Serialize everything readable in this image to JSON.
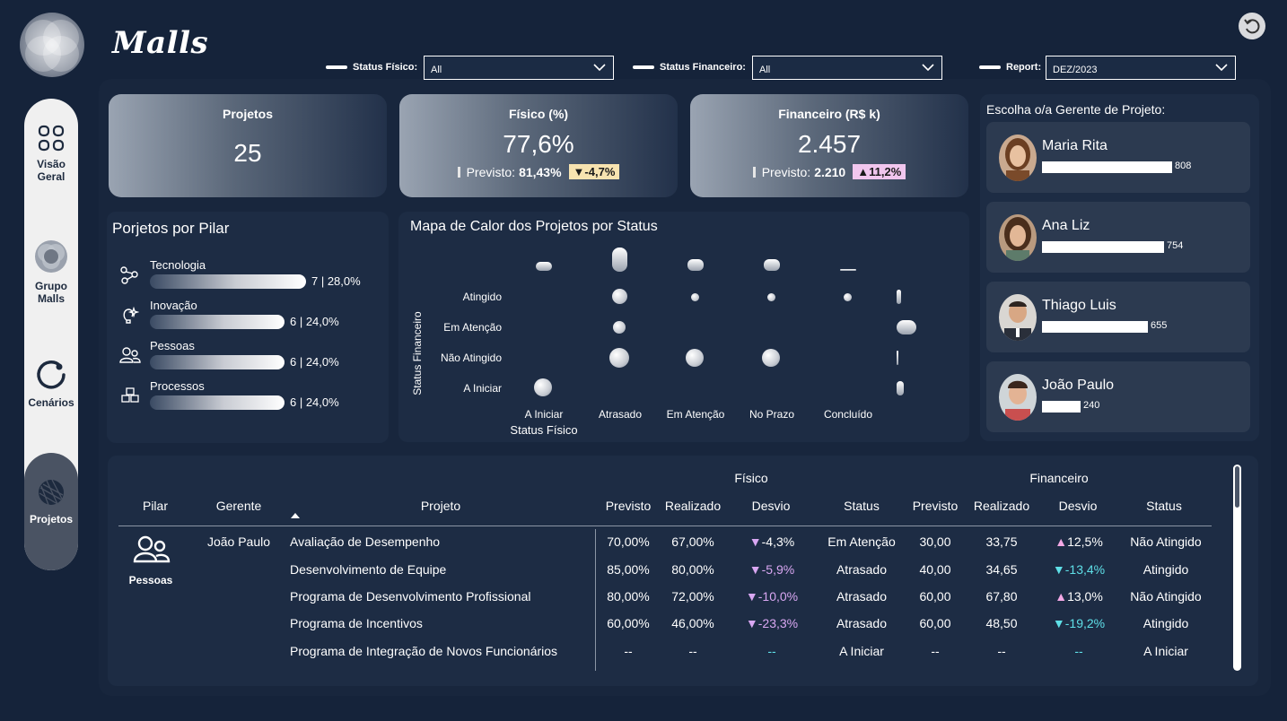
{
  "app": {
    "title": "Malls"
  },
  "sidebar": {
    "items": [
      {
        "label_line1": "Visão",
        "label_line2": "Geral",
        "icon": "grid-icon"
      },
      {
        "label_line1": "Grupo",
        "label_line2": "Malls",
        "icon": "orb-icon"
      },
      {
        "label_line1": "Cenários",
        "label_line2": "",
        "icon": "circle-icon"
      },
      {
        "label_line1": "Projetos",
        "label_line2": "",
        "icon": "globe-icon"
      }
    ]
  },
  "filters": {
    "status_fisico": {
      "label": "Status Físico:",
      "value": "All"
    },
    "status_financeiro": {
      "label": "Status Financeiro:",
      "value": "All"
    },
    "report": {
      "label": "Report:",
      "value": "DEZ/2023"
    }
  },
  "kpis": {
    "projetos": {
      "title": "Projetos",
      "value": "25"
    },
    "fisico": {
      "title": "Físico (%)",
      "value": "77,6%",
      "prev_label": "Previsto:",
      "prev_value": "81,43%",
      "delta": "-4,7%",
      "delta_color": "#f7e3b0"
    },
    "financeiro": {
      "title": "Financeiro (R$ k)",
      "value": "2.457",
      "prev_label": "Previsto:",
      "prev_value": "2.210",
      "delta": "11,2%",
      "delta_color": "#f1c6ee"
    }
  },
  "pilar_panel": {
    "title": "Porjetos por Pilar",
    "rows": [
      {
        "name": "Tecnologia",
        "value": "7 | 28,0%",
        "fraction": 0.28
      },
      {
        "name": "Inovação",
        "value": "6 | 24,0%",
        "fraction": 0.24
      },
      {
        "name": "Pessoas",
        "value": "6 | 24,0%",
        "fraction": 0.24
      },
      {
        "name": "Processos",
        "value": "6 | 24,0%",
        "fraction": 0.24
      }
    ]
  },
  "heatmap": {
    "title": "Mapa de Calor dos Projetos por Status",
    "y_axis_title": "Status Financeiro",
    "x_axis_title": "Status Físico",
    "y_labels": [
      "Atingido",
      "Em Atenção",
      "Não Atingido",
      "A Iniciar"
    ],
    "x_labels": [
      "A Iniciar",
      "Atrasado",
      "Em Atenção",
      "No Prazo",
      "Concluído"
    ]
  },
  "managers": {
    "title": "Escolha o/a Gerente de Projeto:",
    "list": [
      {
        "name": "Maria Rita",
        "value": "808",
        "fraction": 1.0
      },
      {
        "name": "Ana Liz",
        "value": "754",
        "fraction": 0.933
      },
      {
        "name": "Thiago Luis",
        "value": "655",
        "fraction": 0.811
      },
      {
        "name": "João Paulo",
        "value": "240",
        "fraction": 0.297
      }
    ]
  },
  "table": {
    "group_fisico": "Físico",
    "group_financeiro": "Financeiro",
    "headers": [
      "Pilar",
      "Gerente",
      "Projeto",
      "Previsto",
      "Realizado",
      "Desvio",
      "Status",
      "Previsto",
      "Realizado",
      "Desvio",
      "Status"
    ],
    "pilar": "Pessoas",
    "gerente": "João Paulo",
    "rows": [
      {
        "projeto": "Avaliação de Desempenho",
        "f_prev": "70,00%",
        "f_real": "67,00%",
        "f_desv": "-4,3%",
        "f_status": "Em Atenção",
        "fi_prev": "30,00",
        "fi_real": "33,75",
        "fi_desv": "12,5%",
        "fi_status": "Não Atingido"
      },
      {
        "projeto": "Desenvolvimento de Equipe",
        "f_prev": "85,00%",
        "f_real": "80,00%",
        "f_desv": "-5,9%",
        "f_status": "Atrasado",
        "fi_prev": "40,00",
        "fi_real": "34,65",
        "fi_desv": "-13,4%",
        "fi_status": "Atingido"
      },
      {
        "projeto": "Programa de Desenvolvimento Profissional",
        "f_prev": "80,00%",
        "f_real": "72,00%",
        "f_desv": "-10,0%",
        "f_status": "Atrasado",
        "fi_prev": "60,00",
        "fi_real": "67,80",
        "fi_desv": "13,0%",
        "fi_status": "Não Atingido"
      },
      {
        "projeto": "Programa de Incentivos",
        "f_prev": "60,00%",
        "f_real": "46,00%",
        "f_desv": "-23,3%",
        "f_status": "Atrasado",
        "fi_prev": "60,00",
        "fi_real": "48,50",
        "fi_desv": "-19,2%",
        "fi_status": "Atingido"
      },
      {
        "projeto": "Programa de Integração de Novos Funcionários",
        "f_prev": "--",
        "f_real": "--",
        "f_desv": "--",
        "f_status": "A Iniciar",
        "fi_prev": "--",
        "fi_real": "--",
        "fi_desv": "--",
        "fi_status": "A Iniciar"
      }
    ]
  }
}
